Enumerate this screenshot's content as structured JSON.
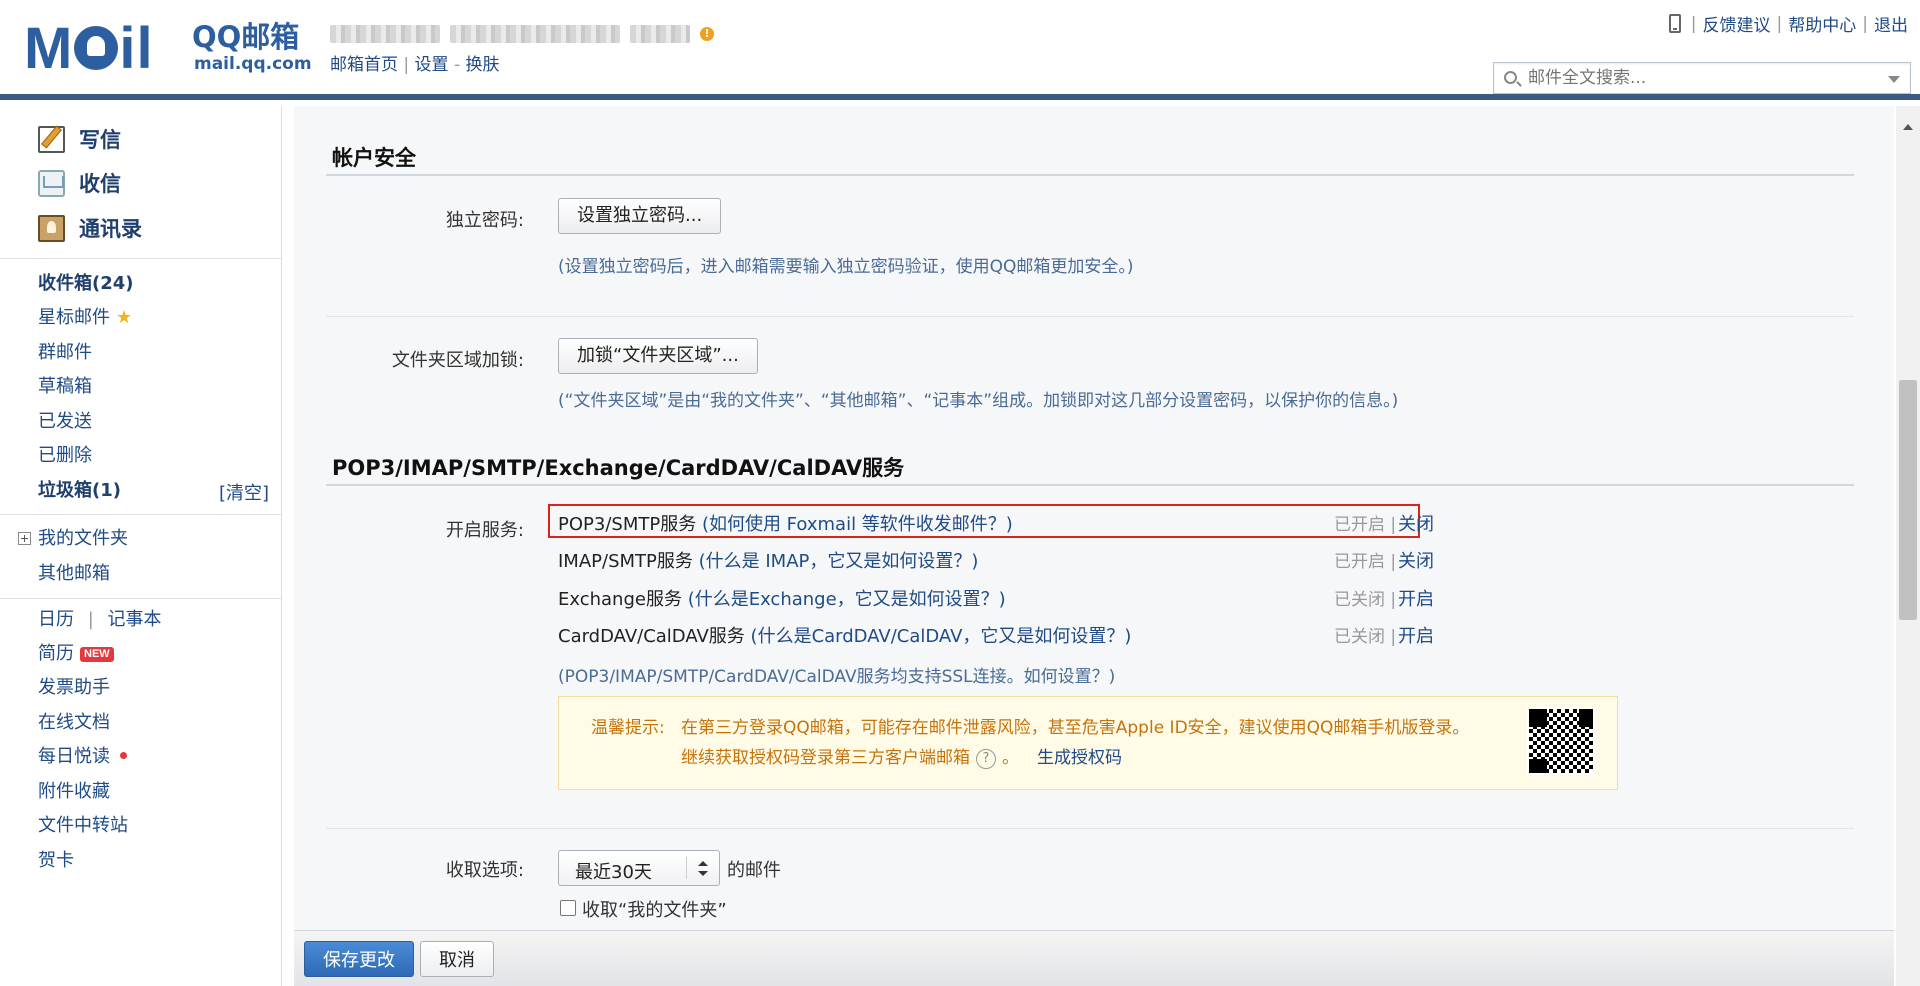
{
  "header": {
    "brand": "QQ邮箱",
    "logo_text": "Moil",
    "domain": "mail.qq.com",
    "subnav": {
      "home": "邮箱首页",
      "sep": "|",
      "settings": "设置",
      "dash": "-",
      "skin": "换肤"
    },
    "toplinks": {
      "feedback": "反馈建议",
      "help": "帮助中心",
      "logout": "退出",
      "sep": "|"
    },
    "search": {
      "placeholder": "邮件全文搜索..."
    }
  },
  "sidebar": {
    "compose": "写信",
    "receive": "收信",
    "contacts": "通讯录",
    "inbox": "收件箱(24)",
    "starred": "星标邮件",
    "group": "群邮件",
    "drafts": "草稿箱",
    "sent": "已发送",
    "deleted": "已删除",
    "spam": "垃圾箱(1)",
    "clear": "[清空]",
    "my_folders": "我的文件夹",
    "other_mail": "其他邮箱",
    "calendar": "日历",
    "calendar_sep": "|",
    "notes": "记事本",
    "resume": "简历",
    "new_badge": "NEW",
    "invoice": "发票助手",
    "docs": "在线文档",
    "daily": "每日悦读",
    "attachments": "附件收藏",
    "transfer": "文件中转站",
    "cards": "贺卡"
  },
  "security": {
    "title": "帐户安全",
    "pwd_label": "独立密码:",
    "pwd_button": "设置独立密码...",
    "pwd_hint": "(设置独立密码后，进入邮箱需要输入独立密码验证，使用QQ邮箱更加安全。)",
    "lock_label": "文件夹区域加锁:",
    "lock_button": "加锁“文件夹区域”...",
    "lock_hint": "(“文件夹区域”是由“我的文件夹”、“其他邮箱”、“记事本”组成。加锁即对这几部分设置密码，以保护你的信息。)"
  },
  "services": {
    "title": "POP3/IMAP/SMTP/Exchange/CardDAV/CalDAV服务",
    "label": "开启服务:",
    "rows": [
      {
        "name": "POP3/SMTP服务",
        "help": "(如何使用 Foxmail 等软件收发邮件？)",
        "state": "已开启 |",
        "toggle": "关闭"
      },
      {
        "name": "IMAP/SMTP服务",
        "help": "(什么是 IMAP，它又是如何设置？)",
        "state": "已开启 |",
        "toggle": "关闭"
      },
      {
        "name": "Exchange服务",
        "help": "(什么是Exchange，它又是如何设置？)",
        "state": "已关闭 |",
        "toggle": "开启"
      },
      {
        "name": "CardDAV/CalDAV服务",
        "help": "(什么是CardDAV/CalDAV，它又是如何设置？)",
        "state": "已关闭 |",
        "toggle": "开启"
      }
    ],
    "ssl_note": "(POP3/IMAP/SMTP/CardDAV/CalDAV服务均支持SSL连接。如何设置？)",
    "tip_label": "温馨提示:",
    "tip_text": "在第三方登录QQ邮箱，可能存在邮件泄露风险，甚至危害Apple ID安全，建议使用QQ邮箱手机版登录。",
    "tip_line2": "继续获取授权码登录第三方客户端邮箱",
    "help_glyph": "?",
    "tip_period": "。",
    "generate": "生成授权码"
  },
  "receive_opts": {
    "label": "收取选项:",
    "range": "最近30天",
    "suffix": "的邮件",
    "include_folders": "收取“我的文件夹”"
  },
  "footer": {
    "save": "保存更改",
    "cancel": "取消"
  },
  "colors": {
    "brand": "#2d5fa0",
    "link": "#1f4b86",
    "highlight": "#d9241c",
    "tip": "#c7730c"
  }
}
